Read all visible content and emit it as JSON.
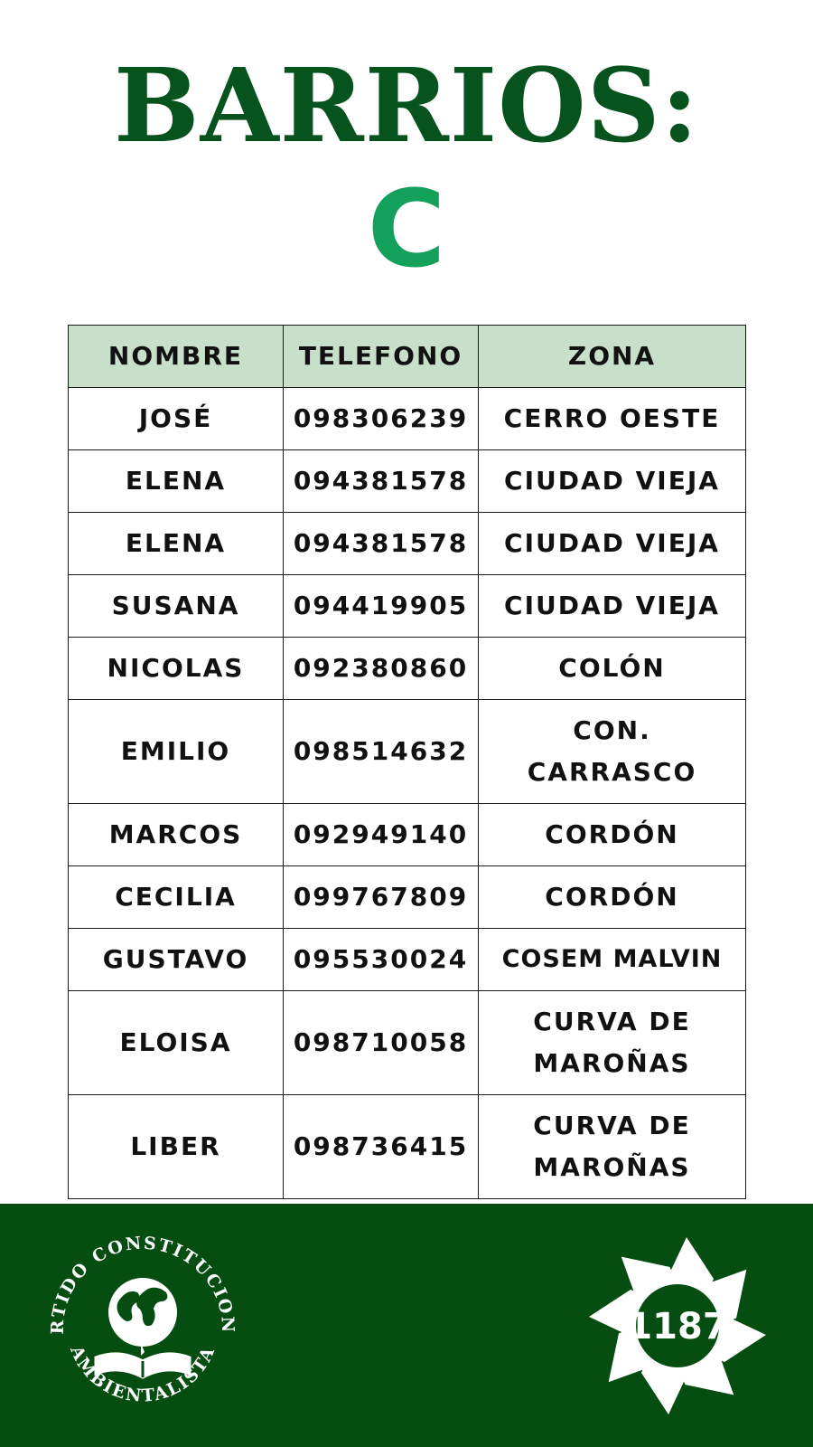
{
  "header": {
    "title": "BARRIOS:",
    "letter": "C"
  },
  "colors": {
    "title": "#07531d",
    "letter": "#12a05b",
    "header_row": "#c8dfc9",
    "footer": "#064d11"
  },
  "table": {
    "columns": [
      "NOMBRE",
      "TELEFONO",
      "ZONA"
    ],
    "rows": [
      {
        "nombre": "JOSÉ",
        "telefono": "098306239",
        "zona": "CERRO OESTE"
      },
      {
        "nombre": "ELENA",
        "telefono": "094381578",
        "zona": "CIUDAD VIEJA"
      },
      {
        "nombre": "ELENA",
        "telefono": "094381578",
        "zona": "CIUDAD VIEJA"
      },
      {
        "nombre": "SUSANA",
        "telefono": "094419905",
        "zona": "CIUDAD VIEJA"
      },
      {
        "nombre": "NICOLAS",
        "telefono": "092380860",
        "zona": "COLÓN"
      },
      {
        "nombre": "EMILIO",
        "telefono": "098514632",
        "zona": "CON. CARRASCO"
      },
      {
        "nombre": "MARCOS",
        "telefono": "092949140",
        "zona": "CORDÓN"
      },
      {
        "nombre": "CECILIA",
        "telefono": "099767809",
        "zona": "CORDÓN"
      },
      {
        "nombre": "GUSTAVO",
        "telefono": "095530024",
        "zona": "COSEM MALVIN"
      },
      {
        "nombre": "ELOISA",
        "telefono": "098710058",
        "zona": "CURVA DE MAROÑAS"
      },
      {
        "nombre": "LIBER",
        "telefono": "098736415",
        "zona": "CURVA DE MAROÑAS"
      }
    ]
  },
  "footer": {
    "party_arc_top": "PARTIDO CONSTITUCIONAL",
    "party_arc_bottom": "AMBIENTALISTA",
    "list_number": "1187"
  }
}
